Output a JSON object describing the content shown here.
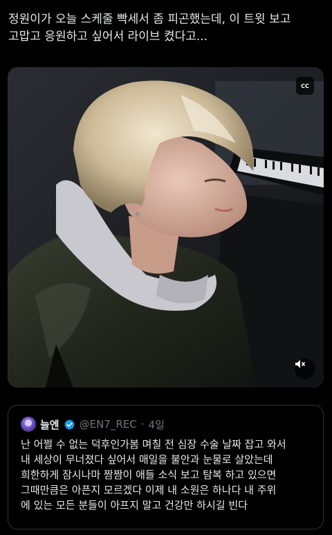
{
  "tweet": {
    "text": "정원이가 오늘 스케줄 빡세서 좀 피곤했는데, 이 트윗 보고\n고맙고 응원하고 싶어서 라이브 켰다고..."
  },
  "media": {
    "cc_label": "CC",
    "cc_icon": "closed-captions-icon",
    "mute_icon": "muted-speaker-icon"
  },
  "quote": {
    "display_name": "늘엔",
    "handle": "@EN7_REC",
    "separator": "·",
    "time": "4일",
    "verified_color": "#1d9bf0",
    "text": "난 어쩔 수 없는 덕후인가봄 며칠 전 심장 수술 날짜 잡고 와서\n내 세상이 무너졌다 싶어서 매일을 불안과 눈물로 살았는데\n희한하게 잠시나마 짬짬이 애들 소식 보고 탐복 하고 있으면\n그때만큼은 아픈지 모르겠다 이제 내 소원은 하나다 내 주위\n에 있는 모든 분들이 아프지 말고 건강만 하시길 빈다"
  }
}
